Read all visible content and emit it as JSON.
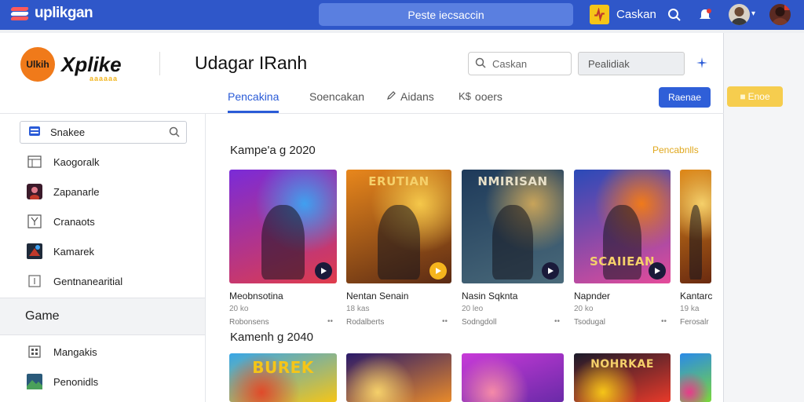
{
  "topbar": {
    "brand": "uplikgan",
    "search_label": "Peste iecsaccin",
    "user_label": "Caskan"
  },
  "header": {
    "logo_badge": "Ulkih",
    "logo_text": "Xplike",
    "logo_sub": "aaaaaa",
    "page_title": "Udagar IRanh",
    "search_placeholder": "Caskan",
    "select_value": "Pealidiak",
    "primary_button": "Raenae",
    "strip_button": "Enoe"
  },
  "tabs": [
    {
      "label": "Pencakina",
      "icon": ""
    },
    {
      "label": "Soencakan",
      "icon": ""
    },
    {
      "label": "Aidans",
      "icon": "pen-icon"
    },
    {
      "label": "ooers",
      "icon": "dollar-icon"
    }
  ],
  "sidebar": {
    "search_label": "Snakee",
    "items_top": [
      {
        "label": "Kaogoralk",
        "icon": "calendar-icon"
      },
      {
        "label": "Zapanarle",
        "icon": "avatar-icon"
      },
      {
        "label": "Cranaots",
        "icon": "y-box-icon"
      },
      {
        "label": "Kamarek",
        "icon": "game-thumb-icon"
      },
      {
        "label": "Gentnanearitial",
        "icon": "bracket-icon"
      }
    ],
    "section": "Game",
    "items_bottom": [
      {
        "label": "Mangakis",
        "icon": "building-icon"
      },
      {
        "label": "Penonidls",
        "icon": "landscape-icon"
      }
    ]
  },
  "content": {
    "section1_title": "Kampe'a g 2020",
    "section1_link": "Pencabnlls",
    "section2_title": "Kamenh g 2040",
    "row1": [
      {
        "art_text": "",
        "title": "Meobnsotina",
        "meta": "20 ko",
        "sub": "Robonsens",
        "colors": [
          "#7a2bd8",
          "#e03c4b",
          "#3fa0f0"
        ]
      },
      {
        "art_text": "ERUTIAN",
        "title": "Nentan Senain",
        "meta": "18 kas",
        "sub": "Rodalberts",
        "colors": [
          "#e8871c",
          "#5a2a14",
          "#f5c84a"
        ]
      },
      {
        "art_text": "NMIRISAN",
        "title": "Nasin Sqknta",
        "meta": "20 leo",
        "sub": "Sodngdoll",
        "colors": [
          "#1e3a5a",
          "#4a6a7a",
          "#c8a45a"
        ]
      },
      {
        "art_text": "SCAIIEAN",
        "title": "Napnder",
        "meta": "20 ko",
        "sub": "Tsodugal",
        "colors": [
          "#2a4ab8",
          "#e54b9a",
          "#f07a1a"
        ]
      },
      {
        "art_text": "",
        "title": "Kantarc",
        "meta": "19 ka",
        "sub": "Ferosalr",
        "colors": [
          "#e08a1a",
          "#6a2a10",
          "#f5d06a"
        ]
      }
    ],
    "row2": [
      {
        "art_text": "BUREK",
        "colors": [
          "#37a6e8",
          "#f5c518",
          "#e04a2a"
        ]
      },
      {
        "art_text": "",
        "colors": [
          "#2a1a6a",
          "#e88a2a",
          "#f5d06a"
        ]
      },
      {
        "art_text": "",
        "colors": [
          "#c83ad8",
          "#6a2aa8",
          "#f58aa8"
        ]
      },
      {
        "art_text": "NOHRKAE",
        "colors": [
          "#1a1a2a",
          "#e83a2a",
          "#f5c518"
        ]
      },
      {
        "art_text": "",
        "colors": [
          "#2a8ae8",
          "#7ad83a",
          "#e83a8a"
        ]
      }
    ]
  },
  "colors": {
    "topbar": "#2f57c9",
    "accent": "#2a5bd7",
    "yellow": "#f6cd4e"
  }
}
